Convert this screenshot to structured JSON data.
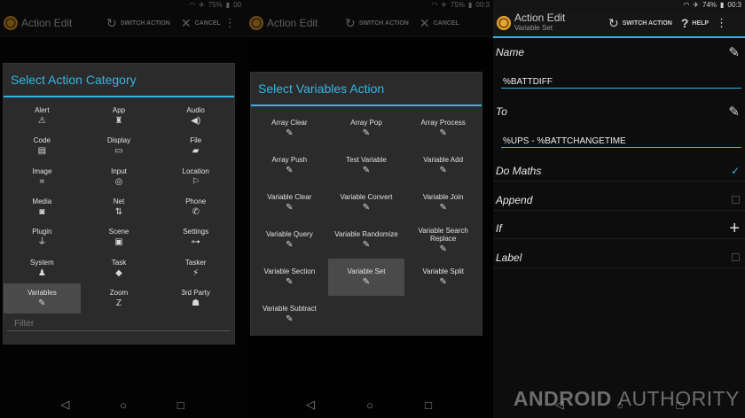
{
  "status": {
    "p1": {
      "battery": "75%",
      "time": "00"
    },
    "p2": {
      "battery": "75%",
      "time": "00:3"
    },
    "p3": {
      "battery": "74%",
      "time": "00:3"
    }
  },
  "actionbar": {
    "title": "Action Edit",
    "subtitle": "Variable Set",
    "switch_action": "SWITCH ACTION",
    "cancel": "CANCEL",
    "help": "HELP"
  },
  "category_dialog": {
    "title": "Select Action Category",
    "filter_placeholder": "Filter",
    "items": [
      {
        "label": "Alert",
        "icon": "⚠"
      },
      {
        "label": "App",
        "icon": "♜"
      },
      {
        "label": "Audio",
        "icon": "◀)"
      },
      {
        "label": "Code",
        "icon": "▤"
      },
      {
        "label": "Display",
        "icon": "▭"
      },
      {
        "label": "File",
        "icon": "▰"
      },
      {
        "label": "Image",
        "icon": "⌗"
      },
      {
        "label": "Input",
        "icon": "◎"
      },
      {
        "label": "Location",
        "icon": "⚐"
      },
      {
        "label": "Media",
        "icon": "◙"
      },
      {
        "label": "Net",
        "icon": "⇅"
      },
      {
        "label": "Phone",
        "icon": "✆"
      },
      {
        "label": "Plugin",
        "icon": "⏚"
      },
      {
        "label": "Scene",
        "icon": "▣"
      },
      {
        "label": "Settings",
        "icon": "⊶"
      },
      {
        "label": "System",
        "icon": "♟"
      },
      {
        "label": "Task",
        "icon": "◆"
      },
      {
        "label": "Tasker",
        "icon": "⚡"
      },
      {
        "label": "Variables",
        "icon": "✎"
      },
      {
        "label": "Zoom",
        "icon": "Z"
      },
      {
        "label": "3rd Party",
        "icon": "☗"
      }
    ],
    "selected": "Variables"
  },
  "variables_dialog": {
    "title": "Select Variables Action",
    "items": [
      {
        "label": "Array Clear",
        "icon": "✎"
      },
      {
        "label": "Array Pop",
        "icon": "✎"
      },
      {
        "label": "Array Process",
        "icon": "✎"
      },
      {
        "label": "Array Push",
        "icon": "✎"
      },
      {
        "label": "Test Variable",
        "icon": "✎"
      },
      {
        "label": "Variable Add",
        "icon": "✎"
      },
      {
        "label": "Variable Clear",
        "icon": "✎"
      },
      {
        "label": "Variable Convert",
        "icon": "✎"
      },
      {
        "label": "Variable Join",
        "icon": "✎"
      },
      {
        "label": "Variable Query",
        "icon": "✎"
      },
      {
        "label": "Variable Randomize",
        "icon": "✎"
      },
      {
        "label": "Variable Search Replace",
        "icon": "✎"
      },
      {
        "label": "Variable Section",
        "icon": "✎"
      },
      {
        "label": "Variable Set",
        "icon": "✎"
      },
      {
        "label": "Variable Split",
        "icon": "✎"
      },
      {
        "label": "Variable Subtract",
        "icon": "✎"
      }
    ],
    "selected": "Variable Set"
  },
  "variable_set": {
    "name_label": "Name",
    "name_value": "%BATTDIFF",
    "to_label": "To",
    "to_value": "%UPS - %BATTCHANGETIME",
    "do_maths_label": "Do Maths",
    "do_maths_checked": true,
    "append_label": "Append",
    "append_checked": false,
    "if_label": "If",
    "label_label": "Label",
    "label_checked": false
  },
  "watermark": {
    "bold": "ANDROID",
    "thin": "AUTHORITY"
  },
  "colors": {
    "accent": "#34b5e5",
    "dialog": "#2b2b2b",
    "selected": "#4a4a4a"
  }
}
